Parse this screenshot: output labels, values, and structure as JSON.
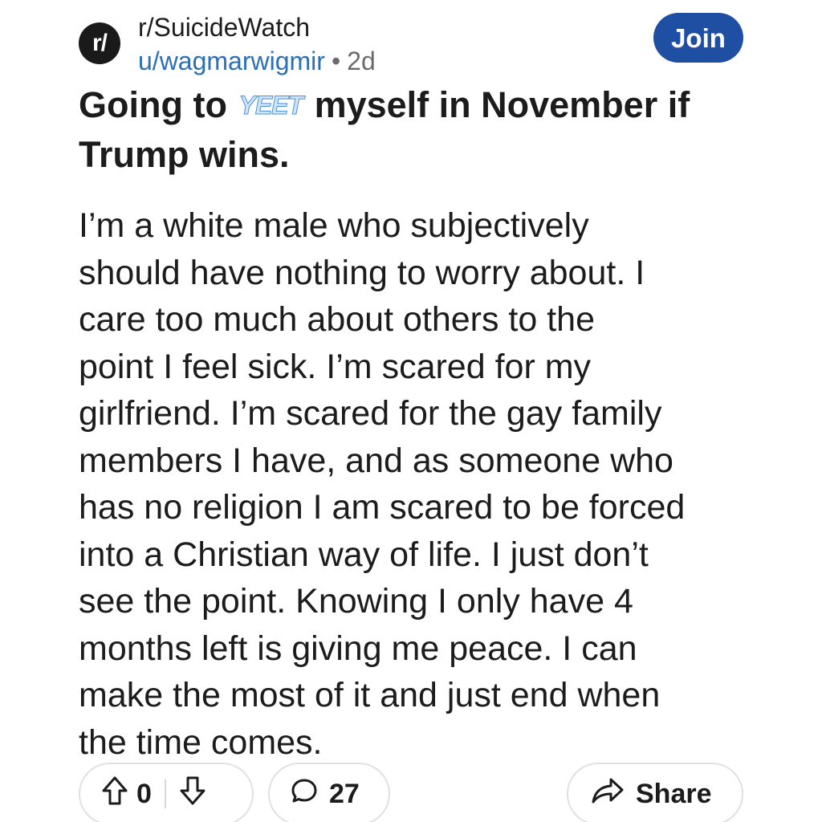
{
  "header": {
    "subreddit_icon_text": "r/",
    "subreddit": "r/SuicideWatch",
    "author": "u/wagmarwigmir",
    "separator": "•",
    "age": "2d",
    "join_label": "Join"
  },
  "post": {
    "title_before": "Going to",
    "title_sticker": "YEET",
    "title_after_line1": "myself in November if",
    "title_line2": "Trump wins.",
    "body_lines": [
      "I’m a white male who subjectively",
      "should have nothing to worry about. I",
      "care too much about others to the",
      "point I feel sick. I’m scared for my",
      "girlfriend. I’m scared for the gay family",
      "members I have, and as someone who",
      "has no religion I am scared to be forced",
      "into a Christian way of life. I just don’t",
      "see the point. Knowing I only have 4",
      "months left is giving me peace. I can",
      "make the most of it and just end when",
      "the time comes."
    ]
  },
  "actions": {
    "vote_count": "0",
    "comment_count": "27",
    "share_label": "Share"
  },
  "colors": {
    "join_button": "#1f4fa3",
    "author_link": "#2b6fb6",
    "pill_border": "#e0e0e0"
  },
  "icons": {
    "upvote": "arrow-up-icon",
    "downvote": "arrow-down-icon",
    "comment": "comment-bubble-icon",
    "share": "share-arrow-icon"
  }
}
